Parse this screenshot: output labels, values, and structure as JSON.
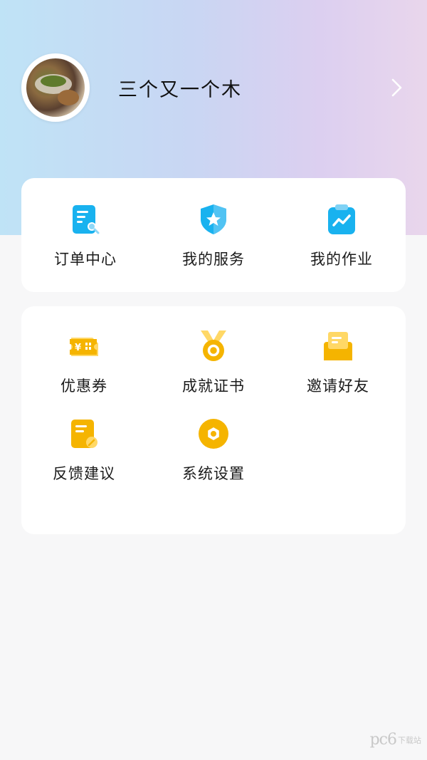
{
  "profile": {
    "username": "三个又一个木"
  },
  "card_main": {
    "items": [
      {
        "label": "订单中心",
        "icon": "order-search-icon",
        "color": "#1ab3f0"
      },
      {
        "label": "我的服务",
        "icon": "shield-star-icon",
        "color": "#1ab3f0"
      },
      {
        "label": "我的作业",
        "icon": "clipboard-chart-icon",
        "color": "#1ab3f0"
      }
    ]
  },
  "card_more": {
    "items": [
      {
        "label": "优惠券",
        "icon": "coupon-icon",
        "color": "#f5b400"
      },
      {
        "label": "成就证书",
        "icon": "medal-icon",
        "color": "#f5b400"
      },
      {
        "label": "邀请好友",
        "icon": "invite-envelope-icon",
        "color": "#f5b400"
      },
      {
        "label": "反馈建议",
        "icon": "feedback-note-icon",
        "color": "#f5b400"
      },
      {
        "label": "系统设置",
        "icon": "settings-hex-icon",
        "color": "#f5b400"
      }
    ]
  },
  "watermark": {
    "brand": "pc6",
    "suffix": "下载站"
  }
}
